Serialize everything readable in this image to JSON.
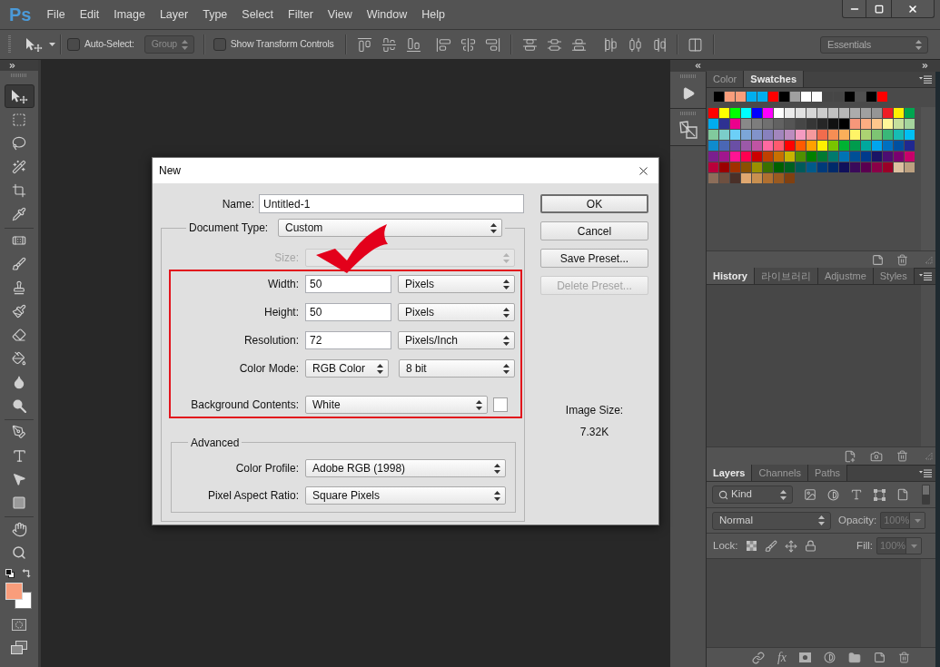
{
  "menu_bar": {
    "logo": "Ps",
    "items": [
      "File",
      "Edit",
      "Image",
      "Layer",
      "Type",
      "Select",
      "Filter",
      "View",
      "Window",
      "Help"
    ]
  },
  "options_bar": {
    "auto_select": {
      "label": "Auto-Select:",
      "checked": false
    },
    "target": {
      "value": "Group",
      "disabled": true
    },
    "transform_controls": {
      "label": "Show Transform Controls",
      "checked": false
    },
    "workspace": {
      "value": "Essentials"
    }
  },
  "toolbar": {
    "tool_groups": [
      [
        {
          "kind": "move",
          "selected": true
        },
        {
          "kind": "marquee",
          "selected": false
        },
        {
          "kind": "lasso",
          "selected": false
        },
        {
          "kind": "quick_select",
          "selected": false
        },
        {
          "kind": "crop",
          "selected": false
        },
        {
          "kind": "eyedropper",
          "selected": false
        }
      ],
      [
        {
          "kind": "healing",
          "selected": false
        },
        {
          "kind": "brush",
          "selected": false
        },
        {
          "kind": "stamp",
          "selected": false
        },
        {
          "kind": "history_brush",
          "selected": false
        },
        {
          "kind": "eraser",
          "selected": false
        },
        {
          "kind": "bucket",
          "selected": false
        },
        {
          "kind": "blur",
          "selected": false
        },
        {
          "kind": "dodge",
          "selected": false
        }
      ],
      [
        {
          "kind": "pen",
          "selected": false
        },
        {
          "kind": "type",
          "selected": false
        },
        {
          "kind": "path_select",
          "selected": false
        },
        {
          "kind": "shape",
          "selected": false
        }
      ],
      [
        {
          "kind": "hand",
          "selected": false
        },
        {
          "kind": "zoom",
          "selected": false
        }
      ]
    ],
    "color_swatches": [
      {
        "kind": "foreground",
        "color": "#f99d7b"
      },
      {
        "kind": "background",
        "color": "#ffffff"
      }
    ]
  },
  "dialog": {
    "title": "New",
    "name": {
      "label": "Name:",
      "value": "Untitled-1"
    },
    "document_type": {
      "label": "Document Type:",
      "value": "Custom"
    },
    "size": {
      "label": "Size:",
      "disabled": true
    },
    "rows": [
      {
        "kind": "dimension",
        "label": "Width:",
        "value": "50",
        "unit": "Pixels"
      },
      {
        "kind": "dimension",
        "label": "Height:",
        "value": "50",
        "unit": "Pixels"
      },
      {
        "kind": "dimension",
        "label": "Resolution:",
        "value": "72",
        "unit": "Pixels/Inch"
      },
      {
        "kind": "mode",
        "label": "Color Mode:",
        "value": "RGB Color",
        "depth": "8 bit"
      },
      {
        "kind": "background",
        "label": "Background Contents:",
        "value": "White",
        "color": "#ffffff"
      }
    ],
    "advanced": {
      "title": "Advanced",
      "rows": [
        {
          "label": "Color Profile:",
          "value": "Adobe RGB (1998)"
        },
        {
          "label": "Pixel Aspect Ratio:",
          "value": "Square Pixels"
        }
      ]
    },
    "buttons": [
      {
        "label": "OK",
        "default": true,
        "disabled": false
      },
      {
        "label": "Cancel",
        "default": false,
        "disabled": false
      },
      {
        "label": "Save Preset...",
        "default": false,
        "disabled": false
      },
      {
        "label": "Delete Preset...",
        "default": false,
        "disabled": true
      }
    ],
    "image_size": {
      "label": "Image Size:",
      "value": "7.32K"
    }
  },
  "swatches_panel": {
    "tabs": [
      {
        "label": "Color",
        "selected": false
      },
      {
        "label": "Swatches",
        "selected": true
      }
    ],
    "recent": [
      {
        "color": "#000000"
      },
      {
        "color": "#f99d7b"
      },
      {
        "color": "#f99d7b"
      },
      {
        "color": "#00aeef"
      },
      {
        "color": "#00aeef"
      },
      {
        "color": "#ff0000"
      },
      {
        "color": "#000000"
      },
      {
        "color": "#a0a0a0"
      },
      {
        "color": "#ffffff"
      },
      {
        "color": "#ffffff"
      },
      {
        "color": "#464646"
      },
      {
        "color": "#464646"
      },
      {
        "color": "#000000"
      },
      {
        "color": "#505050"
      },
      {
        "color": "#000000"
      },
      {
        "color": "#ff0000"
      }
    ],
    "swatches": [
      {
        "color": "#ff0000"
      },
      {
        "color": "#ffff00"
      },
      {
        "color": "#00ff00"
      },
      {
        "color": "#00ffff"
      },
      {
        "color": "#0000ff"
      },
      {
        "color": "#ff00ff"
      },
      {
        "color": "#ffffff"
      },
      {
        "color": "#ebebeb"
      },
      {
        "color": "#e1e1e1"
      },
      {
        "color": "#d7d7d7"
      },
      {
        "color": "#cccccc"
      },
      {
        "color": "#c2c2c2"
      },
      {
        "color": "#b7b7b7"
      },
      {
        "color": "#acacac"
      },
      {
        "color": "#a0a0a0"
      },
      {
        "color": "#959595"
      },
      {
        "color": "#ee1d24"
      },
      {
        "color": "#fff100"
      },
      {
        "color": "#00a650"
      },
      {
        "color": "#00adef"
      },
      {
        "color": "#2e3192"
      },
      {
        "color": "#ec008c"
      },
      {
        "color": "#898989"
      },
      {
        "color": "#7d7d7d"
      },
      {
        "color": "#707070"
      },
      {
        "color": "#626262"
      },
      {
        "color": "#555555"
      },
      {
        "color": "#464646"
      },
      {
        "color": "#363636"
      },
      {
        "color": "#262626"
      },
      {
        "color": "#111111"
      },
      {
        "color": "#000000"
      },
      {
        "color": "#f7977a"
      },
      {
        "color": "#fbad82"
      },
      {
        "color": "#fdc68c"
      },
      {
        "color": "#fff799"
      },
      {
        "color": "#c6df9c"
      },
      {
        "color": "#a4d49d"
      },
      {
        "color": "#81ca9d"
      },
      {
        "color": "#7bcdc9"
      },
      {
        "color": "#6ccff7"
      },
      {
        "color": "#7ca6d8"
      },
      {
        "color": "#8293ca"
      },
      {
        "color": "#8881be"
      },
      {
        "color": "#a286bd"
      },
      {
        "color": "#bc8cbf"
      },
      {
        "color": "#f49bc1"
      },
      {
        "color": "#f5999d"
      },
      {
        "color": "#f16c4d"
      },
      {
        "color": "#f68e54"
      },
      {
        "color": "#fbaf5a"
      },
      {
        "color": "#fff467"
      },
      {
        "color": "#acd372"
      },
      {
        "color": "#7dc473"
      },
      {
        "color": "#39b778"
      },
      {
        "color": "#16bcb4"
      },
      {
        "color": "#00bff3"
      },
      {
        "color": "#0f8bcd"
      },
      {
        "color": "#4a67b5"
      },
      {
        "color": "#6a4fa5"
      },
      {
        "color": "#9b59a8"
      },
      {
        "color": "#c054a3"
      },
      {
        "color": "#ff69a0"
      },
      {
        "color": "#ff5a6e"
      },
      {
        "color": "#ff0000"
      },
      {
        "color": "#ff5a00"
      },
      {
        "color": "#ffa000"
      },
      {
        "color": "#fff000"
      },
      {
        "color": "#79c500"
      },
      {
        "color": "#00b233"
      },
      {
        "color": "#009b4d"
      },
      {
        "color": "#00a89d"
      },
      {
        "color": "#00a5ee"
      },
      {
        "color": "#0070c0"
      },
      {
        "color": "#0050a0"
      },
      {
        "color": "#202890"
      },
      {
        "color": "#7b1f8e"
      },
      {
        "color": "#a1168e"
      },
      {
        "color": "#ff1493"
      },
      {
        "color": "#ff0050"
      },
      {
        "color": "#cc0000"
      },
      {
        "color": "#c04000"
      },
      {
        "color": "#c87000"
      },
      {
        "color": "#c8b400"
      },
      {
        "color": "#509000"
      },
      {
        "color": "#008000"
      },
      {
        "color": "#007a33"
      },
      {
        "color": "#007a6e"
      },
      {
        "color": "#0073b5"
      },
      {
        "color": "#004f96"
      },
      {
        "color": "#003a8c"
      },
      {
        "color": "#1a1466"
      },
      {
        "color": "#4d0e72"
      },
      {
        "color": "#7a0070"
      },
      {
        "color": "#c8006a"
      },
      {
        "color": "#b9003a"
      },
      {
        "color": "#9a0000"
      },
      {
        "color": "#a03000"
      },
      {
        "color": "#8a5000"
      },
      {
        "color": "#9a9000"
      },
      {
        "color": "#3a7000"
      },
      {
        "color": "#006000"
      },
      {
        "color": "#006020"
      },
      {
        "color": "#005a5a"
      },
      {
        "color": "#005a8a"
      },
      {
        "color": "#003a7a"
      },
      {
        "color": "#002a6a"
      },
      {
        "color": "#10105a"
      },
      {
        "color": "#3a0a5a"
      },
      {
        "color": "#5a0050"
      },
      {
        "color": "#8a0048"
      },
      {
        "color": "#9a0028"
      },
      {
        "color": "#dcc0a0"
      },
      {
        "color": "#bca080"
      },
      {
        "color": "#8c6e5a"
      },
      {
        "color": "#6e5040"
      },
      {
        "color": "#4a3028"
      },
      {
        "color": "#e0a870"
      },
      {
        "color": "#c89050"
      },
      {
        "color": "#b07030"
      },
      {
        "color": "#9a5a20"
      },
      {
        "color": "#804010"
      }
    ]
  },
  "history_panel": {
    "tabs": [
      {
        "label": "History",
        "selected": true
      },
      {
        "label": "라이브러리",
        "selected": false
      },
      {
        "label": "Adjustme",
        "selected": false
      },
      {
        "label": "Styles",
        "selected": false
      }
    ]
  },
  "layers_panel": {
    "tabs": [
      {
        "label": "Layers",
        "selected": true
      },
      {
        "label": "Channels",
        "selected": false
      },
      {
        "label": "Paths",
        "selected": false
      }
    ],
    "filter": {
      "value": "Kind"
    },
    "blend_mode": {
      "value": "Normal"
    },
    "opacity": {
      "label": "Opacity:",
      "value": "100%",
      "disabled": true
    },
    "lock": {
      "label": "Lock:"
    },
    "fill": {
      "label": "Fill:",
      "value": "100%",
      "disabled": true
    },
    "effects_button": "fx"
  }
}
